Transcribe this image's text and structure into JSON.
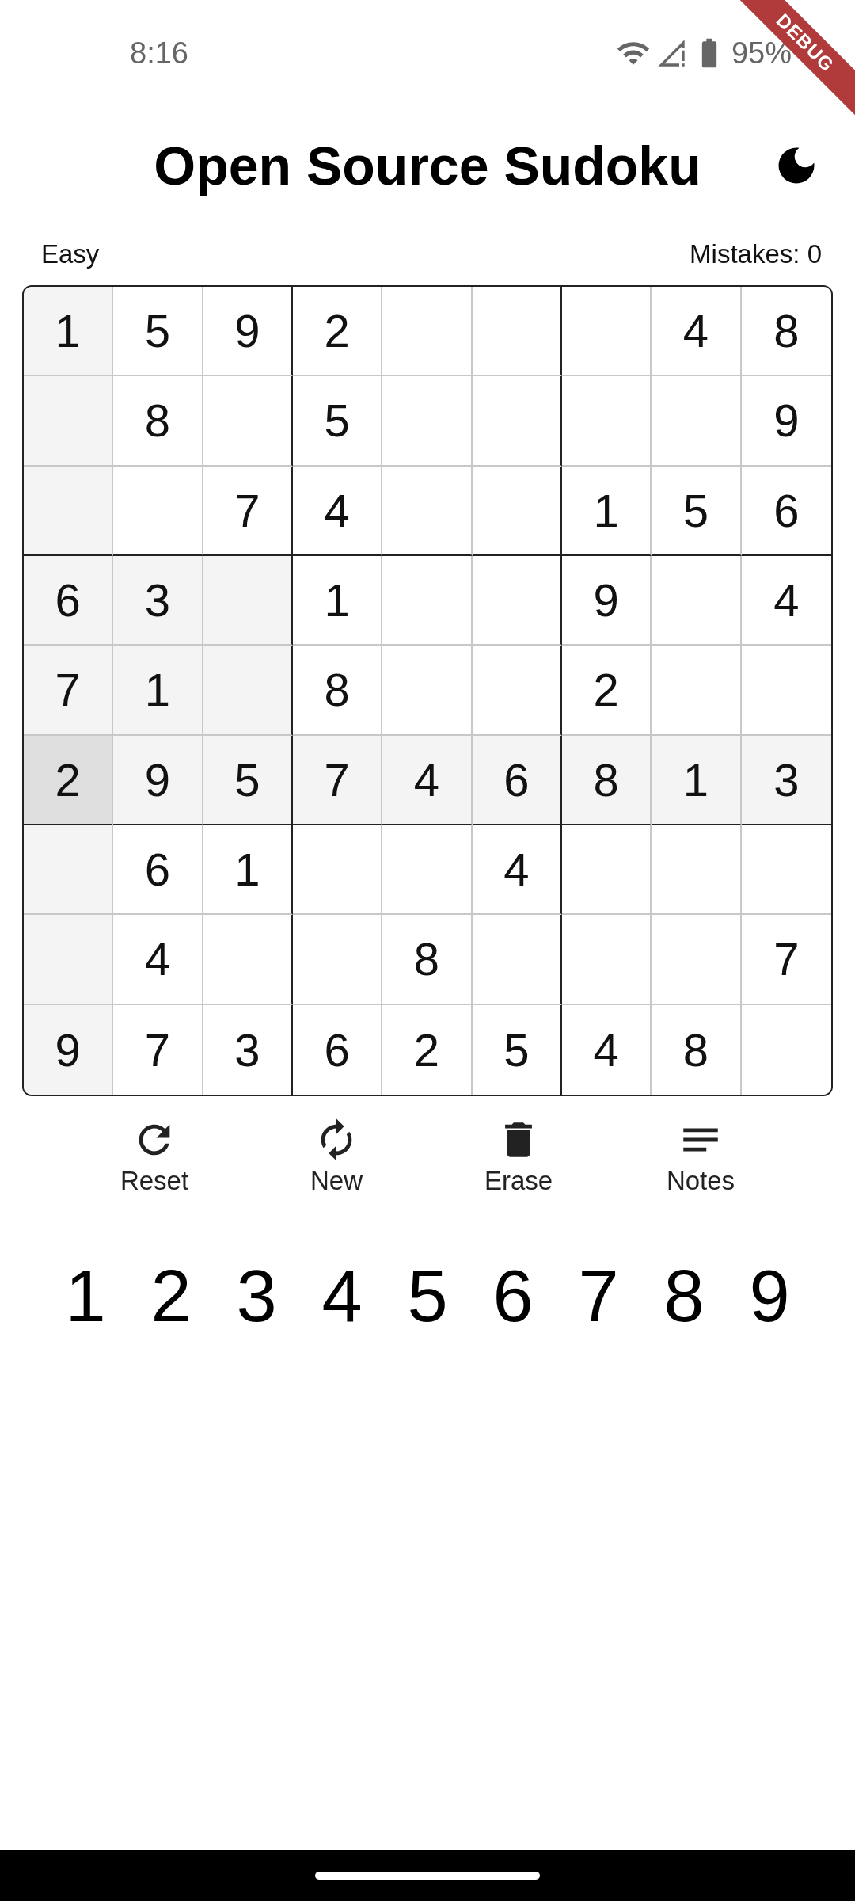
{
  "status_bar": {
    "time": "8:16",
    "battery": "95%"
  },
  "debug_banner": "DEBUG",
  "app_bar": {
    "title": "Open Source Sudoku"
  },
  "game_info": {
    "difficulty": "Easy",
    "mistakes": "Mistakes: 0"
  },
  "board": {
    "rows": [
      [
        {
          "value": "1",
          "selected": false
        },
        {
          "value": "5",
          "selected": false
        },
        {
          "value": "9",
          "selected": false
        },
        {
          "value": "2",
          "selected": false
        },
        {
          "selected": false
        },
        {
          "selected": false
        },
        {
          "selected": false
        },
        {
          "value": "4",
          "selected": false
        },
        {
          "value": "8",
          "selected": false
        }
      ],
      [
        {
          "selected": false
        },
        {
          "value": "8",
          "selected": false
        },
        {
          "selected": false
        },
        {
          "value": "5",
          "selected": false
        },
        {
          "selected": false
        },
        {
          "selected": false
        },
        {
          "selected": false
        },
        {
          "selected": false
        },
        {
          "value": "9",
          "selected": false
        }
      ],
      [
        {
          "selected": false
        },
        {
          "selected": false
        },
        {
          "value": "7",
          "selected": false
        },
        {
          "value": "4",
          "selected": false
        },
        {
          "selected": false
        },
        {
          "selected": false
        },
        {
          "value": "1",
          "selected": false
        },
        {
          "value": "5",
          "selected": false
        },
        {
          "value": "6",
          "selected": false
        }
      ],
      [
        {
          "value": "6",
          "selected": false
        },
        {
          "value": "3",
          "selected": false
        },
        {
          "selected": false
        },
        {
          "value": "1",
          "selected": false
        },
        {
          "selected": false
        },
        {
          "selected": false
        },
        {
          "value": "9",
          "selected": false
        },
        {
          "selected": false
        },
        {
          "value": "4",
          "selected": false
        }
      ],
      [
        {
          "value": "7",
          "selected": false
        },
        {
          "value": "1",
          "selected": false
        },
        {
          "selected": false
        },
        {
          "value": "8",
          "selected": false
        },
        {
          "selected": false
        },
        {
          "selected": false
        },
        {
          "value": "2",
          "selected": false
        },
        {
          "selected": false
        },
        {
          "selected": false
        }
      ],
      [
        {
          "value": "2",
          "selected": true
        },
        {
          "value": "9",
          "selected": false
        },
        {
          "value": "5",
          "selected": false
        },
        {
          "value": "7",
          "selected": false
        },
        {
          "value": "4",
          "selected": false
        },
        {
          "value": "6",
          "selected": false
        },
        {
          "value": "8",
          "selected": false
        },
        {
          "value": "1",
          "selected": false
        },
        {
          "value": "3",
          "selected": false
        }
      ],
      [
        {
          "selected": false
        },
        {
          "value": "6",
          "selected": false
        },
        {
          "value": "1",
          "selected": false
        },
        {
          "selected": false
        },
        {
          "selected": false
        },
        {
          "value": "4",
          "selected": false
        },
        {
          "selected": false
        },
        {
          "selected": false
        },
        {
          "selected": false
        }
      ],
      [
        {
          "selected": false
        },
        {
          "value": "4",
          "selected": false
        },
        {
          "selected": false
        },
        {
          "selected": false
        },
        {
          "value": "8",
          "selected": false
        },
        {
          "selected": false
        },
        {
          "selected": false
        },
        {
          "selected": false
        },
        {
          "value": "7",
          "selected": false
        }
      ],
      [
        {
          "value": "9",
          "selected": false
        },
        {
          "value": "7",
          "selected": false
        },
        {
          "value": "3",
          "selected": false
        },
        {
          "value": "6",
          "selected": false
        },
        {
          "value": "2",
          "selected": false
        },
        {
          "value": "5",
          "selected": false
        },
        {
          "value": "4",
          "selected": false
        },
        {
          "value": "8",
          "selected": false
        },
        {
          "selected": false
        }
      ]
    ]
  },
  "actions": [
    {
      "kind": "reset",
      "label": "Reset"
    },
    {
      "kind": "new",
      "label": "New"
    },
    {
      "kind": "erase",
      "label": "Erase"
    },
    {
      "kind": "notes",
      "label": "Notes"
    }
  ],
  "number_pad": [
    "1",
    "2",
    "3",
    "4",
    "5",
    "6",
    "7",
    "8",
    "9"
  ]
}
